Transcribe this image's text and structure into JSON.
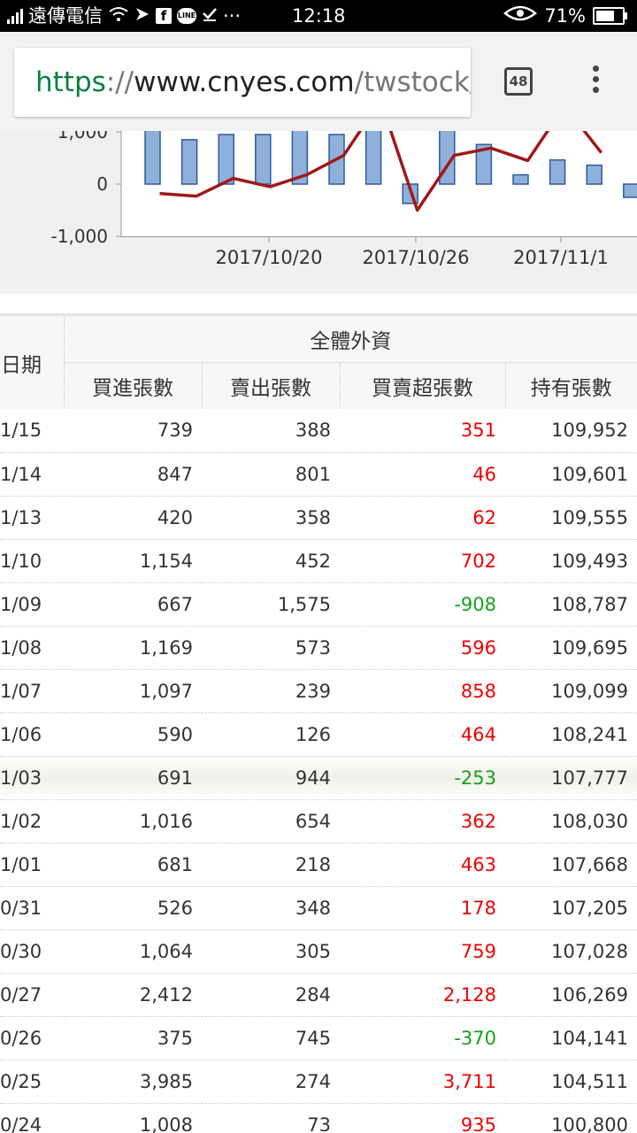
{
  "status_bar": {
    "carrier": "遠傳電信",
    "fb_glyph": "f",
    "line_glyph": "LINE",
    "more": "···",
    "time": "12:18",
    "battery": "71%"
  },
  "browser": {
    "url_scheme": "https",
    "url_sep": "://",
    "url_domain": "www.cnyes.com",
    "url_path": "/twstock/",
    "tab_count": "48"
  },
  "chart_data": {
    "type": "bar",
    "y_tick_labels": [
      "1,000",
      "0",
      "-1,000"
    ],
    "x_tick_labels": [
      "2017/10/20",
      "2017/10/26",
      "2017/11/1"
    ],
    "bar_values": [
      1500,
      850,
      950,
      950,
      1400,
      950,
      1400,
      -370,
      1500,
      759,
      178,
      463,
      362,
      -253
    ],
    "line_values": [
      -180,
      -230,
      110,
      -50,
      180,
      550,
      1600,
      -500,
      550,
      690,
      450,
      1500,
      600
    ],
    "colors": {
      "bar": "#8fb0d9",
      "bar_stroke": "#2e5c99",
      "line": "#a01818"
    }
  },
  "table": {
    "group_header": "全體外資",
    "date_header": "日期",
    "columns": [
      "買進張數",
      "賣出張數",
      "買賣超張數",
      "持有張數"
    ],
    "rows": [
      [
        "1/15",
        "739",
        "388",
        "351",
        "109,952"
      ],
      [
        "1/14",
        "847",
        "801",
        "46",
        "109,601"
      ],
      [
        "1/13",
        "420",
        "358",
        "62",
        "109,555"
      ],
      [
        "1/10",
        "1,154",
        "452",
        "702",
        "109,493"
      ],
      [
        "1/09",
        "667",
        "1,575",
        "-908",
        "108,787"
      ],
      [
        "1/08",
        "1,169",
        "573",
        "596",
        "109,695"
      ],
      [
        "1/07",
        "1,097",
        "239",
        "858",
        "109,099"
      ],
      [
        "1/06",
        "590",
        "126",
        "464",
        "108,241"
      ],
      [
        "1/03",
        "691",
        "944",
        "-253",
        "107,777"
      ],
      [
        "1/02",
        "1,016",
        "654",
        "362",
        "108,030"
      ],
      [
        "1/01",
        "681",
        "218",
        "463",
        "107,668"
      ],
      [
        "0/31",
        "526",
        "348",
        "178",
        "107,205"
      ],
      [
        "0/30",
        "1,064",
        "305",
        "759",
        "107,028"
      ],
      [
        "0/27",
        "2,412",
        "284",
        "2,128",
        "106,269"
      ],
      [
        "0/26",
        "375",
        "745",
        "-370",
        "104,141"
      ],
      [
        "0/25",
        "3,985",
        "274",
        "3,711",
        "104,511"
      ],
      [
        "0/24",
        "1,008",
        "73",
        "935",
        "100,800"
      ]
    ]
  }
}
